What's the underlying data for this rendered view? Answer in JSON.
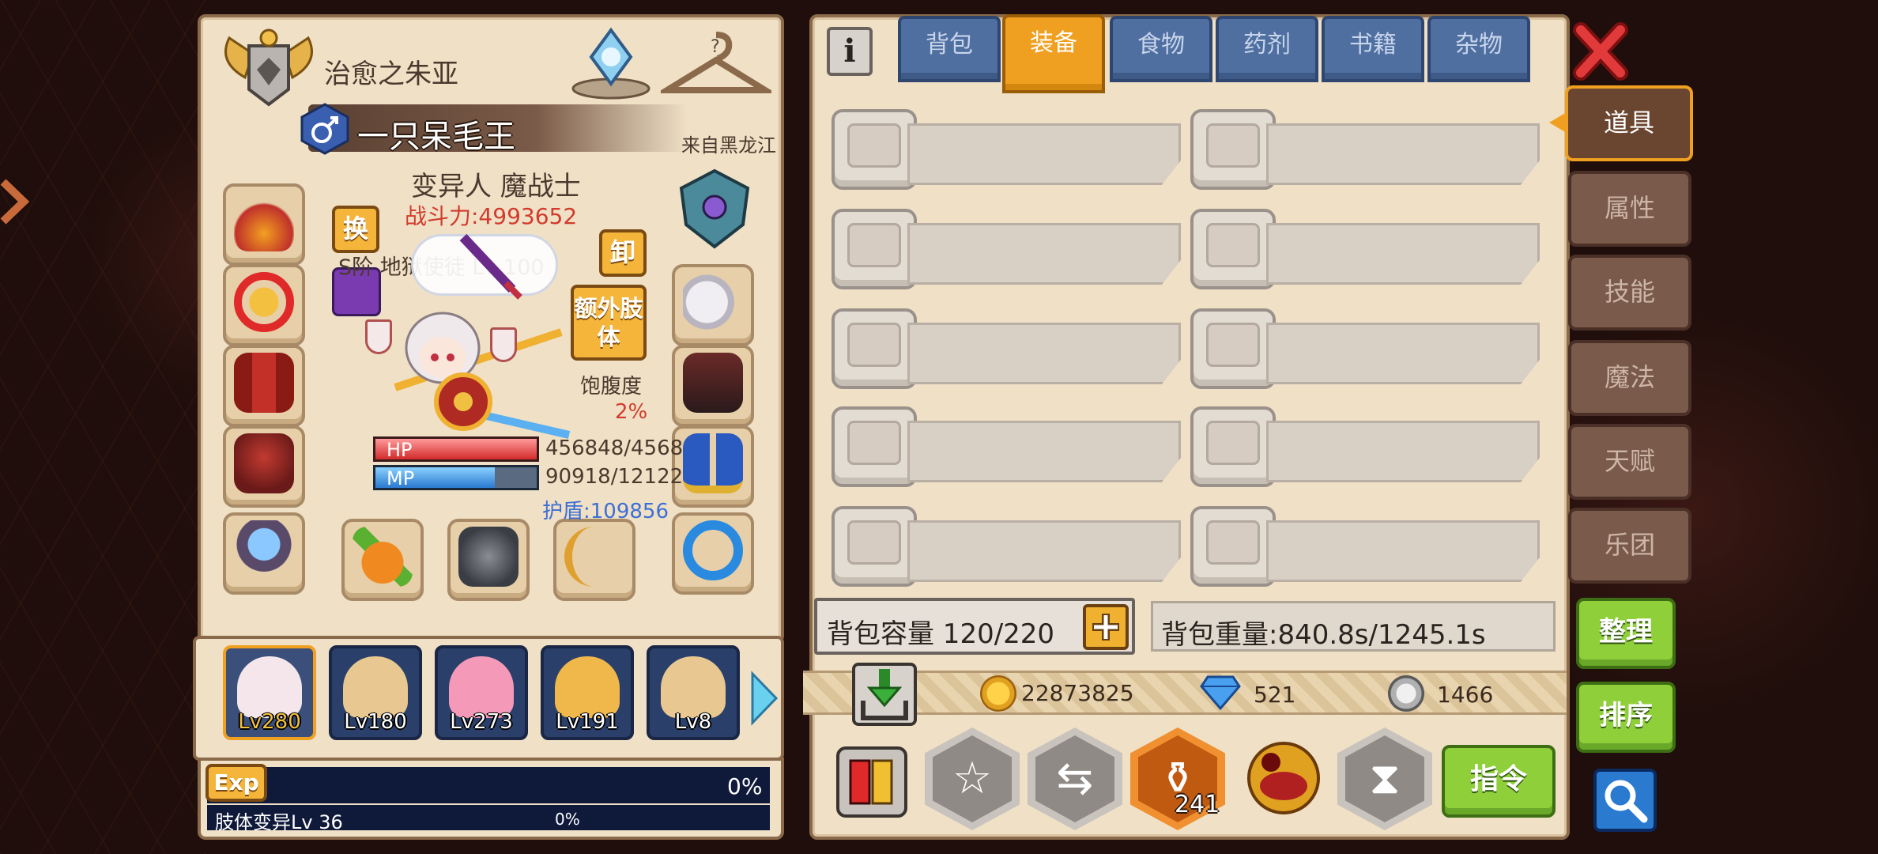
{
  "character": {
    "title": "治愈之朱亚",
    "name": "一只呆毛王",
    "origin": "来自黑龙江",
    "race_class": "变异人 魔战士",
    "power": "战斗力:4993652",
    "weapon_line": "S阶 地狱使徒 Lv 100",
    "swap_label": "换",
    "unequip_label": "卸",
    "extra_limb_label": "额外肢体",
    "satiety_label": "饱腹度",
    "satiety_value": "2%",
    "hp_label": "HP",
    "hp_value": "456848/4568",
    "mp_label": "MP",
    "mp_value": "90918/12122",
    "shield": "护盾:109856"
  },
  "party": [
    {
      "level": "Lv280",
      "selected": true
    },
    {
      "level": "Lv180",
      "selected": false
    },
    {
      "level": "Lv273",
      "selected": false
    },
    {
      "level": "Lv191",
      "selected": false
    },
    {
      "level": "Lv8",
      "selected": false
    }
  ],
  "exp": {
    "label": "Exp",
    "percent": "0%",
    "mutation_label": "肢体变异Lv 36",
    "mutation_percent": "0%"
  },
  "inventory": {
    "info_icon": "i",
    "tabs": [
      "背包",
      "装备",
      "食物",
      "药剂",
      "书籍",
      "杂物"
    ],
    "active_tab": "装备",
    "side_tabs": [
      "道具",
      "属性",
      "技能",
      "魔法",
      "天赋",
      "乐团"
    ],
    "active_side_tab": "道具",
    "capacity": "背包容量 120/220",
    "weight": "背包重量:840.8s/1245.1s",
    "gold": "22873825",
    "diamonds": "521",
    "silver": "1466",
    "potion_count": "241",
    "command_label": "指令",
    "sort_label": "整理",
    "order_label": "排序"
  },
  "colors": {
    "accent": "#f0a020",
    "tab_blue": "#4f6fa1",
    "panel": "#efe0c6",
    "power_red": "#d23b2c",
    "shield_blue": "#3d6fd6",
    "green_button": "#8fcf3a"
  }
}
